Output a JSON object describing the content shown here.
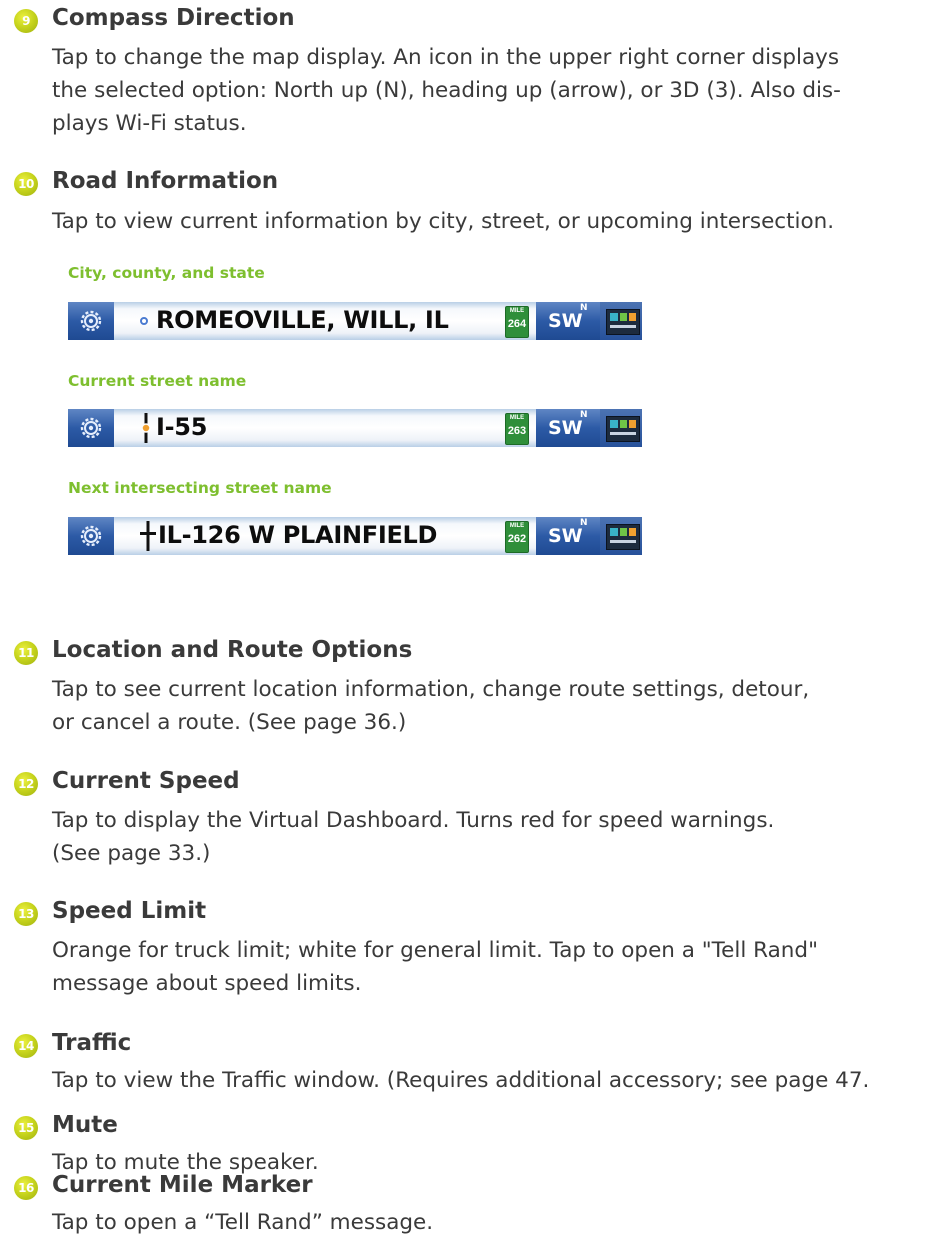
{
  "sections": [
    {
      "number": "9",
      "title": "Compass Direction",
      "lines": [
        "Tap to change the map display. An icon in the upper right corner displays",
        "the selected option: North up (N), heading up (arrow), or 3D (3). Also dis-",
        "plays Wi-Fi status."
      ]
    },
    {
      "number": "10",
      "title": "Road Information",
      "lines": [
        "Tap to view current information by city, street, or upcoming intersection."
      ]
    },
    {
      "number": "11",
      "title": "Location and Route Options",
      "lines": [
        "Tap to see current location information, change route settings, detour,",
        "or cancel a route. (See page 36.)"
      ]
    },
    {
      "number": "12",
      "title": "Current Speed",
      "lines": [
        "Tap to display the Virtual Dashboard. Turns red for speed warnings.",
        "(See page 33.)"
      ]
    },
    {
      "number": "13",
      "title": "Speed Limit",
      "lines": [
        "Orange for truck limit; white for general limit. Tap to open a \"Tell Rand\"",
        "message about speed limits."
      ]
    },
    {
      "number": "14",
      "title": "Traffic",
      "lines": [
        "Tap to view the Traffic window. (Requires additional accessory; see page 47."
      ]
    },
    {
      "number": "15",
      "title": "Mute",
      "lines": [
        "Tap to mute the speaker."
      ]
    },
    {
      "number": "16",
      "title": "Current Mile Marker",
      "lines": [
        "Tap to open a “Tell Rand” message."
      ]
    }
  ],
  "road_bars": [
    {
      "caption": "City, county, and state",
      "road_text": "ROMEOVILLE, WILL, IL",
      "mile_label": "MILE",
      "mile_number": "264",
      "compass": "SW",
      "north": "N"
    },
    {
      "caption": "Current street name",
      "road_text": "I-55",
      "mile_label": "MILE",
      "mile_number": "263",
      "compass": "SW",
      "north": "N"
    },
    {
      "caption": "Next intersecting street name",
      "road_text": "IL-126 W PLAINFIELD",
      "mile_label": "MILE",
      "mile_number": "262",
      "compass": "SW",
      "north": "N"
    }
  ]
}
